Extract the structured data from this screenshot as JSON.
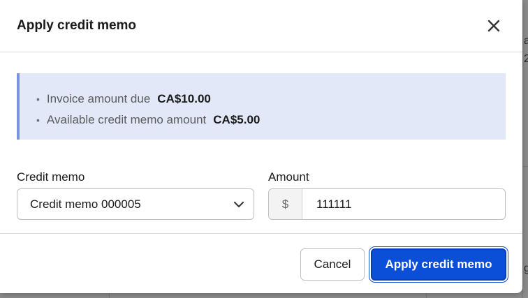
{
  "background": {
    "fragments": [
      "at",
      "2",
      "g"
    ]
  },
  "modal": {
    "title": "Apply credit memo",
    "close_icon": "close-icon",
    "info": {
      "items": [
        {
          "label": "Invoice amount due",
          "value": "CA$10.00"
        },
        {
          "label": "Available credit memo amount",
          "value": "CA$5.00"
        }
      ]
    },
    "credit_memo": {
      "label": "Credit memo",
      "selected": "Credit memo 000005",
      "chevron_icon": "chevron-down-icon"
    },
    "amount": {
      "label": "Amount",
      "currency_symbol": "$",
      "value": "111111"
    },
    "buttons": {
      "cancel": "Cancel",
      "apply": "Apply credit memo"
    }
  },
  "colors": {
    "primary": "#0b4fd8",
    "info_bg": "#e3e8f8",
    "info_accent": "#7a93dc"
  }
}
